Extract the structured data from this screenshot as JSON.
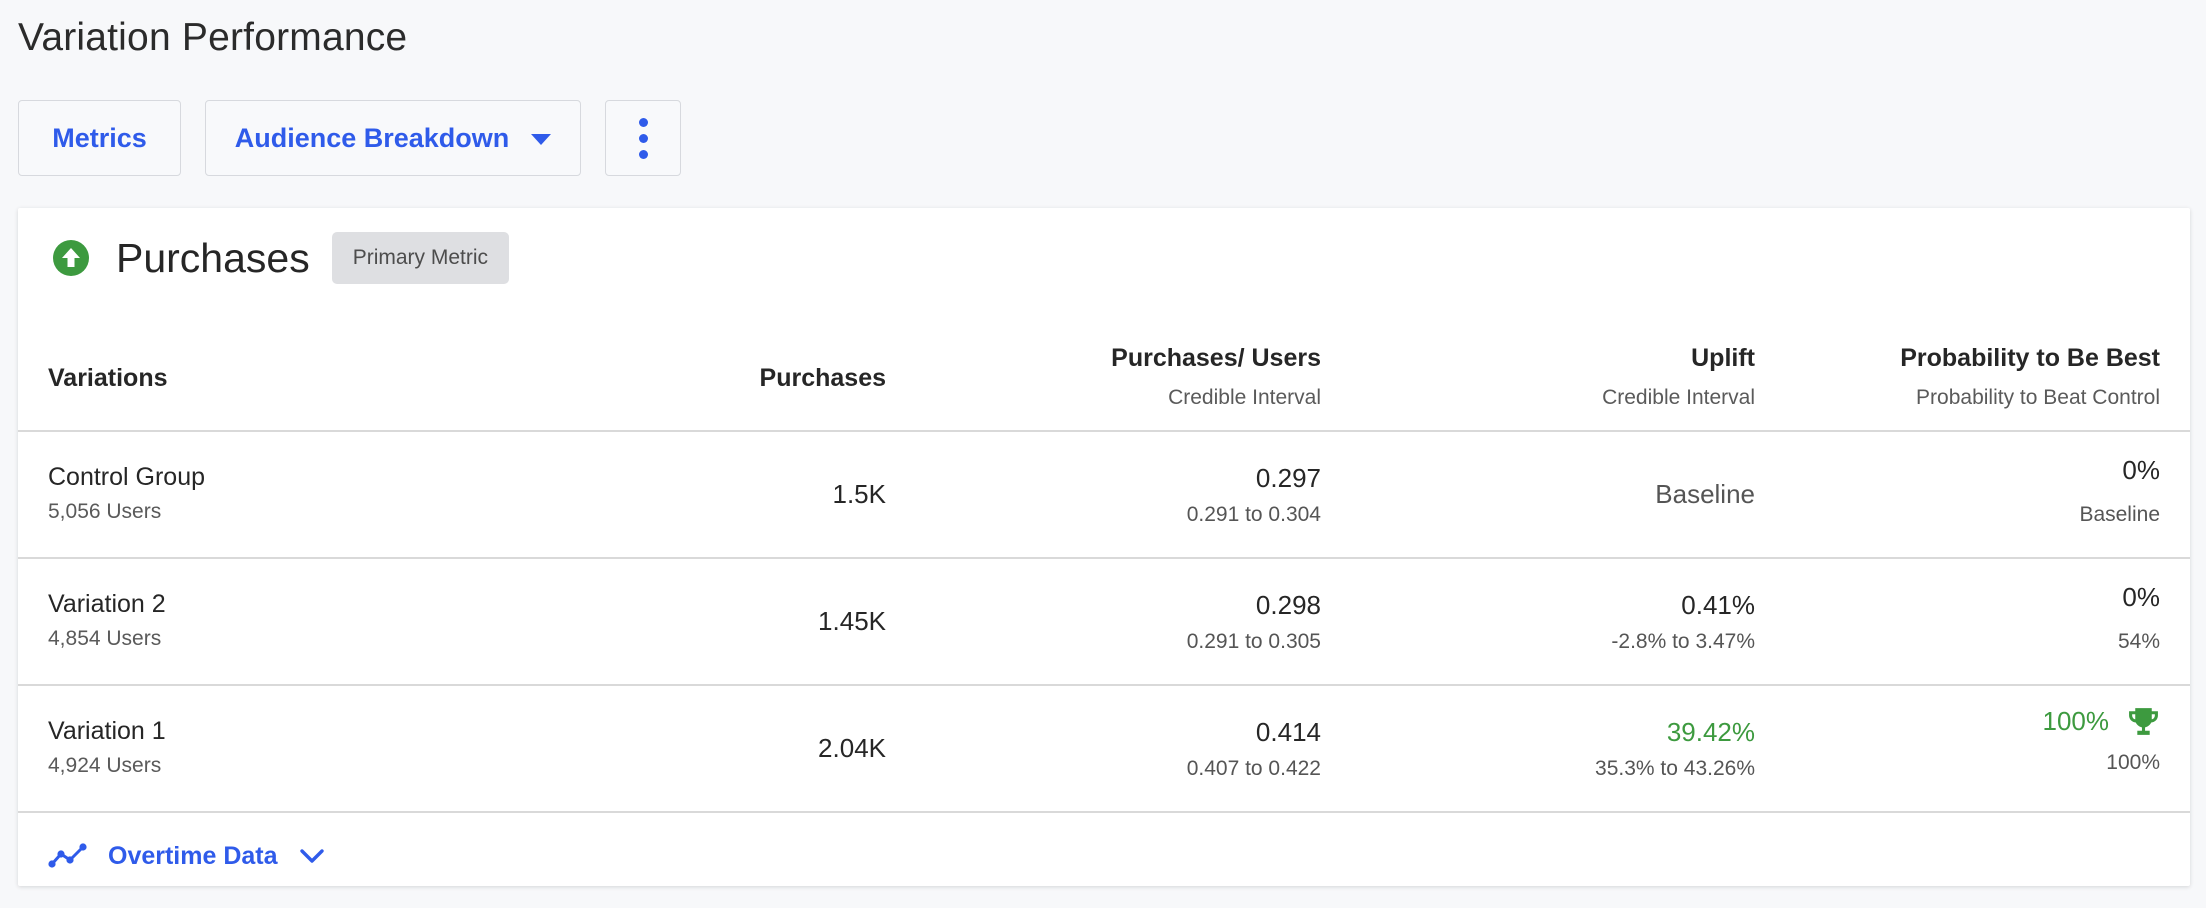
{
  "page": {
    "title": "Variation Performance"
  },
  "toolbar": {
    "metrics_label": "Metrics",
    "audience_label": "Audience Breakdown",
    "more_icon": "more-vertical-icon"
  },
  "metric": {
    "name": "Purchases",
    "badge": "Primary Metric",
    "status_icon": "arrow-up-circle-icon"
  },
  "table": {
    "headers": {
      "variations": "Variations",
      "purchases": "Purchases",
      "rate": "Purchases/ Users",
      "rate_sub": "Credible Interval",
      "uplift": "Uplift",
      "uplift_sub": "Credible Interval",
      "prob": "Probability to Be Best",
      "prob_sub": "Probability to Beat Control"
    },
    "rows": [
      {
        "name": "Control Group",
        "users": "5,056 Users",
        "purchases": "1.5K",
        "rate": "0.297",
        "rate_ci": "0.291 to 0.304",
        "uplift": "Baseline",
        "uplift_ci": "",
        "prob_best": "0%",
        "prob_beat": "Baseline"
      },
      {
        "name": "Variation 2",
        "users": "4,854 Users",
        "purchases": "1.45K",
        "rate": "0.298",
        "rate_ci": "0.291 to 0.305",
        "uplift": "0.41%",
        "uplift_ci": "-2.8% to 3.47%",
        "prob_best": "0%",
        "prob_beat": "54%"
      },
      {
        "name": "Variation 1",
        "users": "4,924 Users",
        "purchases": "2.04K",
        "rate": "0.414",
        "rate_ci": "0.407 to 0.422",
        "uplift": "39.42%",
        "uplift_ci": "35.3% to 43.26%",
        "prob_best": "100%",
        "prob_beat": "100%",
        "winner_icon": "trophy-icon"
      }
    ]
  },
  "footer": {
    "label": "Overtime Data",
    "icon": "trend-line-icon",
    "toggle_icon": "chevron-down-icon"
  },
  "colors": {
    "accent": "#2f5bea",
    "positive": "#3d9a3f",
    "badge_bg": "#dedfe2"
  }
}
